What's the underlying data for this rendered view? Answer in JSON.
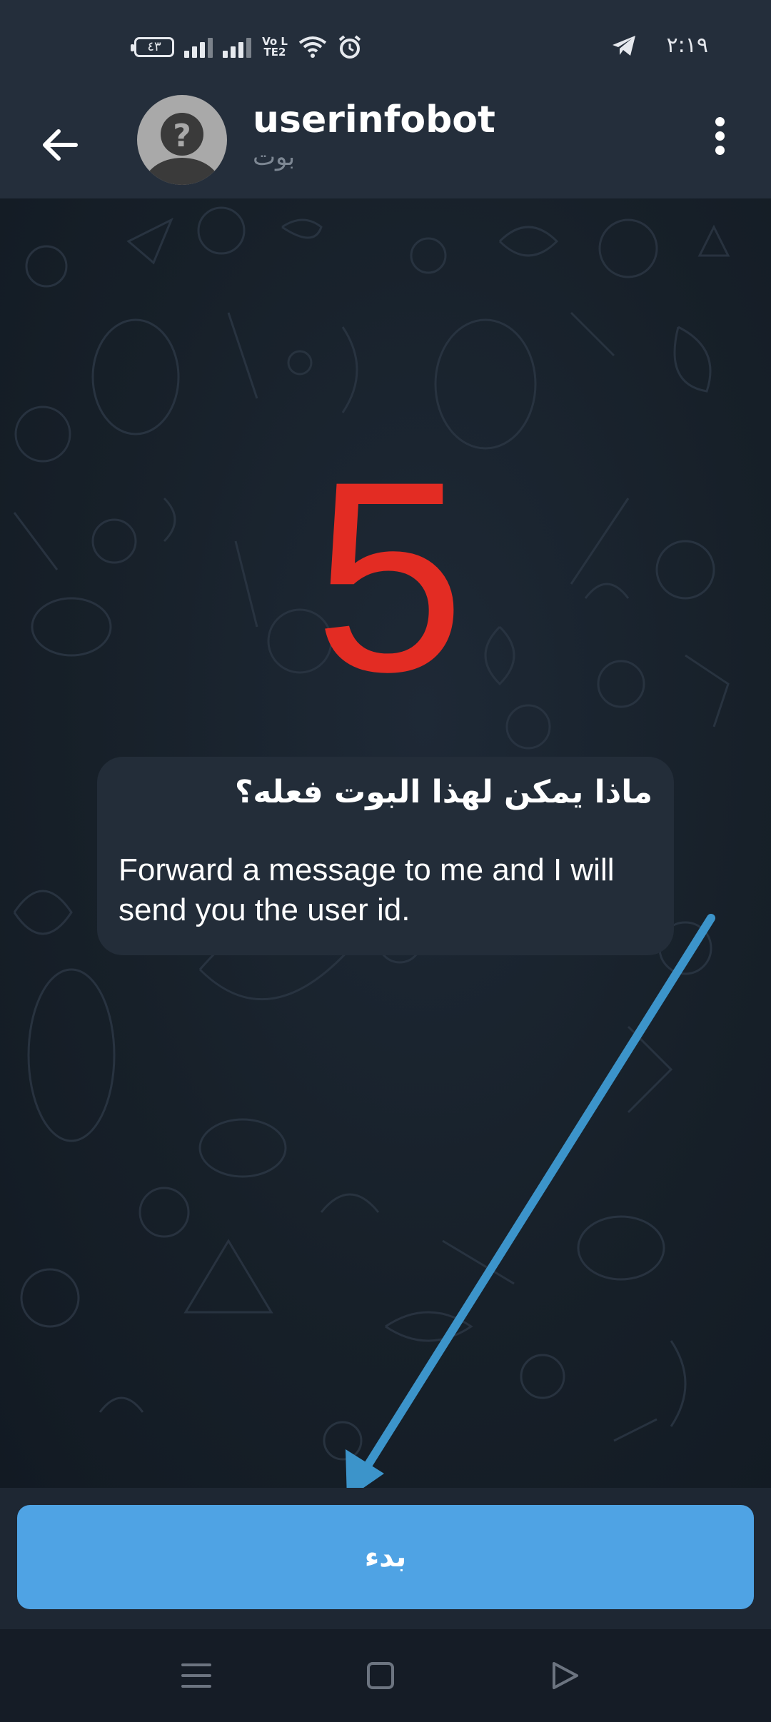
{
  "status_bar": {
    "battery": "٤٣",
    "volte": "Vo LTE2",
    "time": "٢:١٩",
    "icons": [
      "battery-icon",
      "signal-icon",
      "volte-icon",
      "wifi-icon",
      "alarm-icon",
      "telegram-icon"
    ]
  },
  "header": {
    "title": "userinfobot",
    "subtitle": "بوت",
    "back_icon": "back-arrow-icon",
    "menu_icon": "more-vertical-icon"
  },
  "chat": {
    "annotation_number": "5",
    "bubble_title": "ماذا يمكن لهذا البوت فعله؟",
    "bubble_text": "Forward a message to me and I will send you the user id."
  },
  "bottom": {
    "start_label": "بدء"
  },
  "nav": {
    "icons": [
      "menu-icon",
      "home-square-icon",
      "back-triangle-icon"
    ]
  },
  "colors": {
    "header_bg": "#242e3b",
    "chat_bg": "#172029",
    "bubble_bg": "#232d39",
    "accent_button": "#4fa3e4",
    "annotation_red": "#e32c23",
    "annotation_arrow": "#3c94ca"
  }
}
